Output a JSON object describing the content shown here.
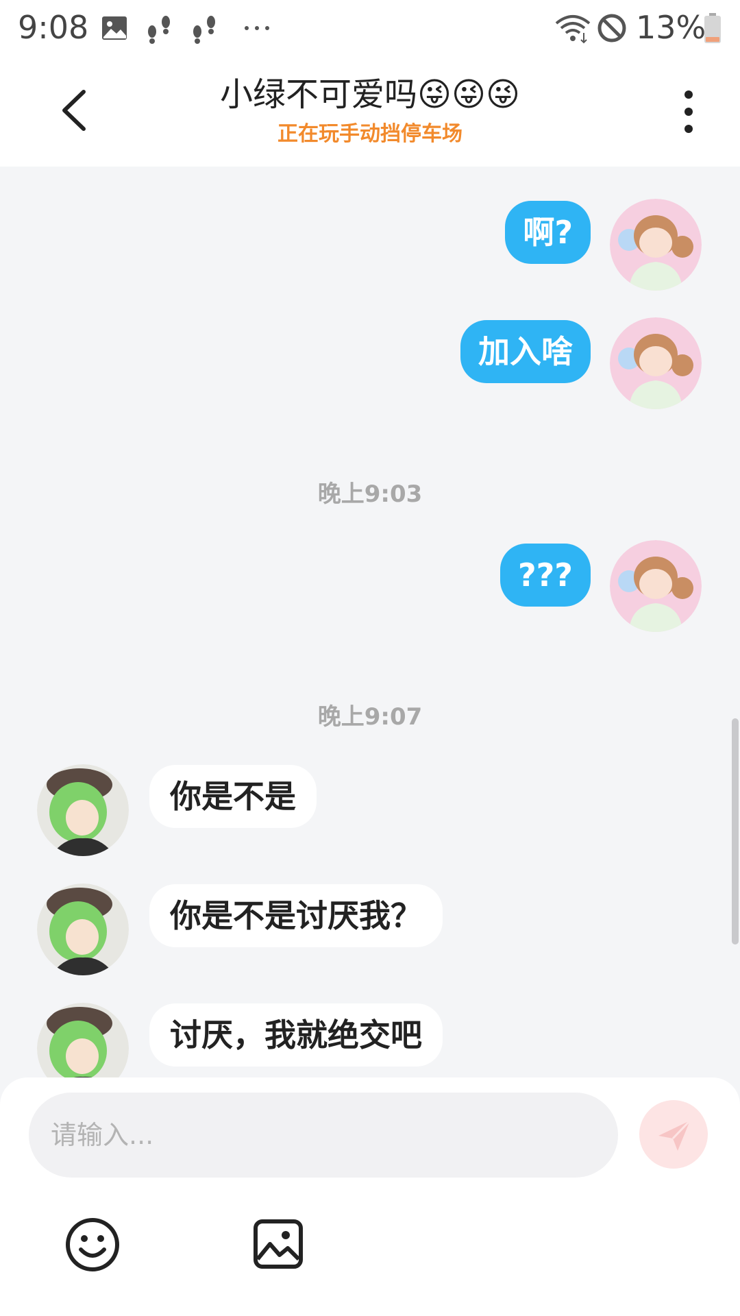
{
  "status_bar": {
    "time": "9:08",
    "battery": "13%"
  },
  "header": {
    "title": "小绿不可爱吗😜😜😜",
    "subtitle": "正在玩手动挡停车场"
  },
  "messages": {
    "out1": "啊?",
    "out2": "加入啥",
    "time1": "晚上9:03",
    "out3": "???",
    "time2": "晚上9:07",
    "in1": "你是不是",
    "in2": "你是不是讨厌我？",
    "in3": "讨厌，我就绝交吧"
  },
  "input": {
    "placeholder": "请输入..."
  },
  "icons": {
    "status": [
      "gallery-icon",
      "footprints-icon",
      "footprints-icon",
      "more-dots-icon",
      "wifi-icon",
      "do-not-disturb-icon",
      "battery-icon"
    ],
    "header": [
      "back-arrow-icon",
      "more-vertical-icon"
    ],
    "toolbar": [
      "send-icon",
      "emoji-icon",
      "image-icon"
    ]
  },
  "colors": {
    "accent_blue": "#2fb4f4",
    "subtitle_orange": "#f28a2c",
    "send_button_bg": "#fde4e4"
  }
}
